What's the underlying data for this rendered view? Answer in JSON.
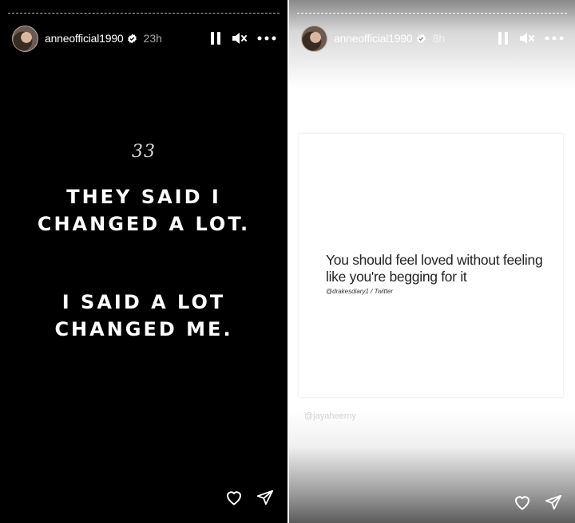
{
  "left_story": {
    "username": "anneofficial1990",
    "time": "23h",
    "quote_mark": "33",
    "line1": "THEY SAID I\nCHANGED A LOT.",
    "line2": "I SAID A LOT\nCHANGED ME.",
    "icons": [
      "pause-icon",
      "mute-icon",
      "more-icon",
      "heart-icon",
      "send-icon"
    ]
  },
  "right_story": {
    "username": "anneofficial1990",
    "time": "8h",
    "post_quote": "You should feel loved without feeling like you're begging for it",
    "post_credit": "@drakesdiary1 / Twitter",
    "watermark": "@jayaheerny",
    "icons": [
      "pause-icon",
      "mute-icon",
      "more-icon",
      "heart-icon",
      "send-icon"
    ]
  },
  "colors": {
    "left_background": "#000000",
    "right_background": "#ffffff",
    "text_light": "#ffffff"
  }
}
